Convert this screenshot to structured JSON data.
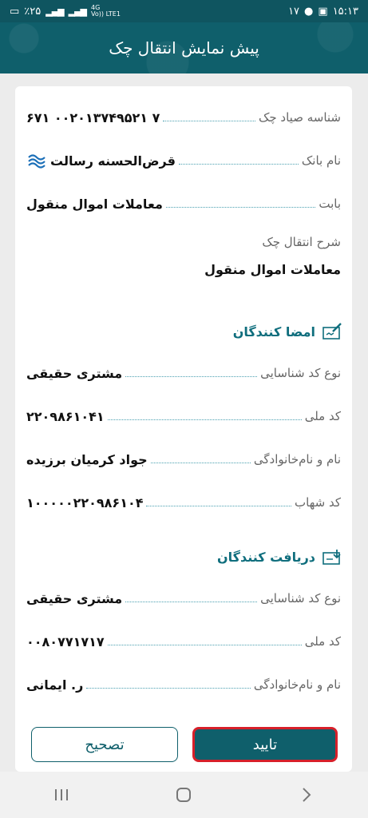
{
  "status_bar": {
    "battery": "٪۲۵",
    "network_4g": "4G",
    "network_volte": "Vo)) LTE1",
    "notification_count": "۱۷",
    "time": "۱۵:۱۳"
  },
  "header": {
    "title": "پیش نمایش انتقال چک"
  },
  "check_info": {
    "sayad_id": {
      "label": "شناسه صیاد چک",
      "value": "۶۷۱ ۰۰۲۰۱۳۷۴۹۵۲۱ ۷"
    },
    "bank_name": {
      "label": "نام بانک",
      "value": "قرض‌الحسنه رسالت",
      "logo_icon": "bank-resalat-logo"
    },
    "reason": {
      "label": "بابت",
      "value": "معاملات اموال منقول"
    },
    "description": {
      "label": "شرح انتقال چک",
      "value": "معاملات اموال منقول"
    }
  },
  "signers": {
    "title": "امضا کنندگان",
    "icon": "signature-icon",
    "id_type": {
      "label": "نوع کد شناسایی",
      "value": "مشتری حقیقی"
    },
    "national_code": {
      "label": "کد ملی",
      "value": "۲۲۰۹۸۶۱۰۴۱"
    },
    "full_name": {
      "label": "نام و نام‌خانوادگی",
      "value": "جواد کرمیان برزیده"
    },
    "shahab_code": {
      "label": "کد شهاب",
      "value": "۱۰۰۰۰۰۲۲۰۹۸۶۱۰۴"
    }
  },
  "receivers": {
    "title": "دریافت کنندگان",
    "icon": "receive-icon",
    "id_type": {
      "label": "نوع کد شناسایی",
      "value": "مشتری حقیقی"
    },
    "national_code": {
      "label": "کد ملی",
      "value": "۰۰۸۰۷۷۱۷۱۷"
    },
    "full_name": {
      "label": "نام و نام‌خانوادگی",
      "value": "ر. ایمانی"
    }
  },
  "actions": {
    "confirm_label": "تایید",
    "edit_label": "تصحیح"
  },
  "colors": {
    "primary": "#0f5f6b",
    "highlight": "#d7202a",
    "accent_text": "#0f6e7d"
  }
}
